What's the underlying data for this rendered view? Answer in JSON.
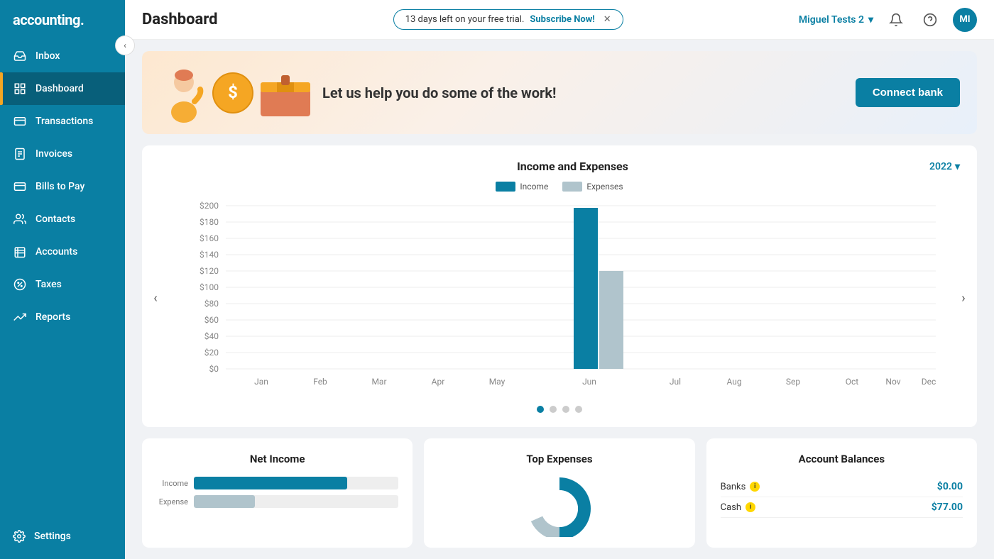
{
  "sidebar": {
    "logo": "accounting.",
    "collapse_arrow": "‹",
    "items": [
      {
        "id": "inbox",
        "label": "Inbox",
        "icon": "inbox"
      },
      {
        "id": "dashboard",
        "label": "Dashboard",
        "icon": "dashboard",
        "active": true
      },
      {
        "id": "transactions",
        "label": "Transactions",
        "icon": "transactions"
      },
      {
        "id": "invoices",
        "label": "Invoices",
        "icon": "invoices"
      },
      {
        "id": "bills",
        "label": "Bills to Pay",
        "icon": "bills"
      },
      {
        "id": "contacts",
        "label": "Contacts",
        "icon": "contacts"
      },
      {
        "id": "accounts",
        "label": "Accounts",
        "icon": "accounts"
      },
      {
        "id": "taxes",
        "label": "Taxes",
        "icon": "taxes"
      },
      {
        "id": "reports",
        "label": "Reports",
        "icon": "reports"
      }
    ],
    "settings_label": "Settings"
  },
  "header": {
    "title": "Dashboard",
    "trial_text": "13 days left on your free trial.",
    "subscribe_text": "Subscribe Now!",
    "user": "Miguel Tests 2",
    "avatar_initials": "MI"
  },
  "promo": {
    "text": "Let us help you do some of the work!",
    "button_label": "Connect bank"
  },
  "chart": {
    "title": "Income and Expenses",
    "year": "2022",
    "legend_income": "Income",
    "legend_expenses": "Expenses",
    "months": [
      "Jan",
      "Feb",
      "Mar",
      "Apr",
      "May",
      "Jun",
      "Jul",
      "Aug",
      "Sep",
      "Oct",
      "Nov",
      "Dec"
    ],
    "y_labels": [
      "$200",
      "$180",
      "$160",
      "$140",
      "$120",
      "$100",
      "$80",
      "$60",
      "$40",
      "$20",
      "$0"
    ],
    "income_values": [
      0,
      0,
      0,
      0,
      0,
      190,
      0,
      0,
      0,
      0,
      0,
      0
    ],
    "expense_values": [
      0,
      0,
      0,
      0,
      0,
      120,
      0,
      0,
      0,
      0,
      0,
      0
    ],
    "dots": [
      1,
      2,
      3,
      4
    ],
    "active_dot": 1,
    "nav_left": "‹",
    "nav_right": "›"
  },
  "net_income": {
    "title": "Net Income",
    "income_label": "Income",
    "expense_label": "Expense",
    "income_pct": 75,
    "expense_pct": 30
  },
  "top_expenses": {
    "title": "Top Expenses"
  },
  "account_balances": {
    "title": "Account Balances",
    "rows": [
      {
        "label": "Banks",
        "amount": "$0.00"
      },
      {
        "label": "Cash",
        "amount": "$77.00"
      }
    ]
  }
}
